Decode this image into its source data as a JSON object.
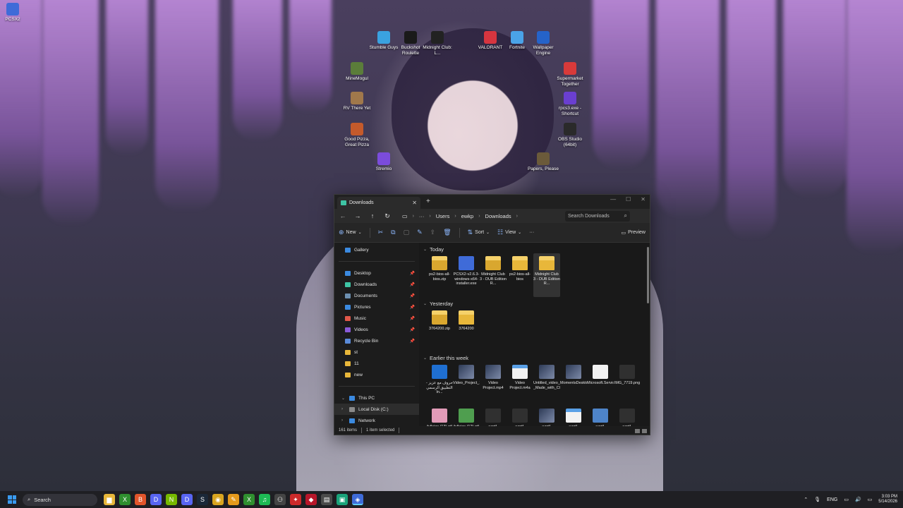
{
  "desktop": {
    "icons": [
      {
        "label": "PCSX2",
        "icon": "pcsx2-icon",
        "color": "#3f6bd8"
      },
      {
        "label": "Stumble Guys",
        "icon": "stumble-guys-icon",
        "color": "#3aa2e0"
      },
      {
        "label": "Buckshot Roulette",
        "icon": "buckshot-roulette-icon",
        "color": "#1a1a1a"
      },
      {
        "label": "Midnight Club: L...",
        "icon": "midnight-club-icon",
        "color": "#222222"
      },
      {
        "label": "VALORANT",
        "icon": "valorant-icon",
        "color": "#d6353f"
      },
      {
        "label": "Fortnite",
        "icon": "fortnite-icon",
        "color": "#4aa3e8"
      },
      {
        "label": "Wallpaper Engine",
        "icon": "wallpaper-engine-icon",
        "color": "#2563c9"
      },
      {
        "label": "MineMogul",
        "icon": "minemogul-icon",
        "color": "#5b7d3a"
      },
      {
        "label": "Supermarket Together",
        "icon": "supermarket-together-icon",
        "color": "#d83a3a"
      },
      {
        "label": "RV There Yet",
        "icon": "rv-there-yet-icon",
        "color": "#a0784b"
      },
      {
        "label": "rpcs3.exe - Shortcut",
        "icon": "rpcs3-icon",
        "color": "#6a3fd0"
      },
      {
        "label": "Good Pizza, Great Pizza",
        "icon": "good-pizza-icon",
        "color": "#c45a2b"
      },
      {
        "label": "OBS Studio (64bit)",
        "icon": "obs-studio-icon",
        "color": "#2a2a2a"
      },
      {
        "label": "Stremio",
        "icon": "stremio-icon",
        "color": "#7b4cdc"
      },
      {
        "label": "Papers, Please",
        "icon": "papers-please-icon",
        "color": "#6b5a3a"
      }
    ]
  },
  "explorer": {
    "tab_title": "Downloads",
    "tab_close": "✕",
    "new_tab": "+",
    "breadcrumb": [
      "Users",
      "ewkp",
      "Downloads"
    ],
    "breadcrumb_more": "···",
    "search_placeholder": "Search Downloads",
    "toolbar": {
      "new": "New",
      "sort": "Sort",
      "view": "View",
      "more": "···",
      "preview": "Preview"
    },
    "nav": {
      "gallery": "Gallery",
      "quick": [
        {
          "label": "Desktop",
          "color": "#3b8ae0"
        },
        {
          "label": "Downloads",
          "color": "#3ec4a4"
        },
        {
          "label": "Documents",
          "color": "#6c8fb0"
        },
        {
          "label": "Pictures",
          "color": "#3b8ae0"
        },
        {
          "label": "Music",
          "color": "#e0584a"
        },
        {
          "label": "Videos",
          "color": "#8a5ad8"
        },
        {
          "label": "Recycle Bin",
          "color": "#5a8ad8"
        }
      ],
      "folders": [
        "st",
        "11",
        "new"
      ],
      "this_pc": "This PC",
      "local_disk": "Local Disk (C:)",
      "network": "Network"
    },
    "groups": [
      {
        "header": "Today",
        "files": [
          {
            "name": "ps2-bios-all-bios.zip",
            "type": "zip"
          },
          {
            "name": "PCSX2-v2.6.3-windows-x64-installer.exe",
            "type": "exe"
          },
          {
            "name": "Midnight Club 3 - DUB Edition R...",
            "type": "zip"
          },
          {
            "name": "ps2-bios-all-bios",
            "type": "folder"
          },
          {
            "name": "Midnight Club 3 - DUB Edition R...",
            "type": "folder",
            "selected": true
          }
        ]
      },
      {
        "header": "Yesterday",
        "files": [
          {
            "name": "3764200.zip",
            "type": "zip"
          },
          {
            "name": "3764200",
            "type": "folder"
          }
        ]
      },
      {
        "header": "Earlier this week",
        "files": [
          {
            "name": "حروف مع عزيز - التطبيق الرسمي In...",
            "type": "dl"
          },
          {
            "name": "Video_Project_1_1.mp4",
            "type": "vid"
          },
          {
            "name": "Video Project.mp4",
            "type": "vid"
          },
          {
            "name": "Video Project.m4a",
            "type": "m4a"
          },
          {
            "name": "Untitled_video_-_Made_with_Clipchamp_5...",
            "type": "vid"
          },
          {
            "name": "MomentsDesktopclipfromMar1026.mp4",
            "type": "vid"
          },
          {
            "name": "Microsoft.Services.Store.winmd",
            "type": "doc"
          },
          {
            "name": "IMG_7719.png",
            "type": "dark"
          },
          {
            "name": "fullsize (13).gif",
            "type": "pink"
          },
          {
            "name": "fullsize (12).gif",
            "type": "green"
          },
          {
            "name": "ezgif-344065781f84991f.png",
            "type": "dark"
          },
          {
            "name": "ezgif-8020e10d1021957 6.png",
            "type": "dark"
          },
          {
            "name": "ezgif-6517d34079af266 a.webm",
            "type": "vid"
          },
          {
            "name": "ezgif-372c9ebcfcd0c5c1.mp3",
            "type": "m4a"
          },
          {
            "name": "ezgif-61b44ae15d260d52.webp",
            "type": "blue"
          },
          {
            "name": "ezgif-36b7f8e62dd5fe3c.PNG",
            "type": "dark"
          }
        ]
      }
    ],
    "status": {
      "items": "161 items",
      "selected": "1 item selected"
    }
  },
  "taskbar": {
    "search": "Search",
    "apps": [
      {
        "icon": "file-explorer-icon",
        "color": "#e8b73a",
        "glyph": "▆"
      },
      {
        "icon": "xbox-icon",
        "color": "#2f8f2f",
        "glyph": "X"
      },
      {
        "icon": "brave-icon",
        "color": "#e2552b",
        "glyph": "B"
      },
      {
        "icon": "discord-icon",
        "color": "#5865f2",
        "glyph": "D"
      },
      {
        "icon": "nvidia-icon",
        "color": "#76b900",
        "glyph": "N"
      },
      {
        "icon": "discord-alt-icon",
        "color": "#5865f2",
        "glyph": "D"
      },
      {
        "icon": "steam-icon",
        "color": "#1b2838",
        "glyph": "S"
      },
      {
        "icon": "chrome-icon",
        "color": "#d9a520",
        "glyph": "◉"
      },
      {
        "icon": "pen-app-icon",
        "color": "#e59a1c",
        "glyph": "✎"
      },
      {
        "icon": "xbox-alt-icon",
        "color": "#2f8f2f",
        "glyph": "X"
      },
      {
        "icon": "spotify-icon",
        "color": "#1db954",
        "glyph": "♫"
      },
      {
        "icon": "controller-icon",
        "color": "#444444",
        "glyph": "⚇"
      },
      {
        "icon": "game-app-icon",
        "color": "#cc2a2a",
        "glyph": "✦"
      },
      {
        "icon": "roblox-icon",
        "color": "#b8162a",
        "glyph": "◆"
      },
      {
        "icon": "notepad-icon",
        "color": "#4b4b4b",
        "glyph": "▤"
      },
      {
        "icon": "terminal-icon",
        "color": "#1aa37a",
        "glyph": "▣"
      },
      {
        "icon": "pcsx2-taskbar-icon",
        "color": "#3f6bd8",
        "glyph": "◈"
      }
    ],
    "lang": "ENG",
    "time": "3:03 PM",
    "date": "5/14/2026"
  }
}
